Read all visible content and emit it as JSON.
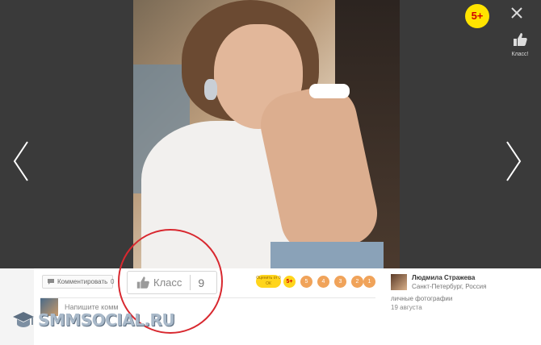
{
  "viewer": {
    "age_badge": "5+",
    "close_icon": "close-icon",
    "side_klass_label": "Класс!",
    "prev_icon": "chevron-left-icon",
    "next_icon": "chevron-right-icon"
  },
  "actions": {
    "comment_label": "Комментировать",
    "comment_count": "0",
    "klass_label": "Класс",
    "klass_count": "9"
  },
  "rating": {
    "label": "Оценить от 0 ОК",
    "options": [
      "5+",
      "5",
      "4",
      "3",
      "2",
      "1"
    ]
  },
  "comment": {
    "placeholder": "Напишите комм"
  },
  "author": {
    "name": "Людмила Стражева",
    "city": "Санкт-Петербург, Россия",
    "album": "личные фотографии",
    "date": "19 августа"
  },
  "watermark": {
    "text": "SMMSOCIAL.RU"
  },
  "colors": {
    "badge_yellow": "#ffe400",
    "rating_orange": "#f0a35a",
    "highlight_red": "#d8282f"
  }
}
